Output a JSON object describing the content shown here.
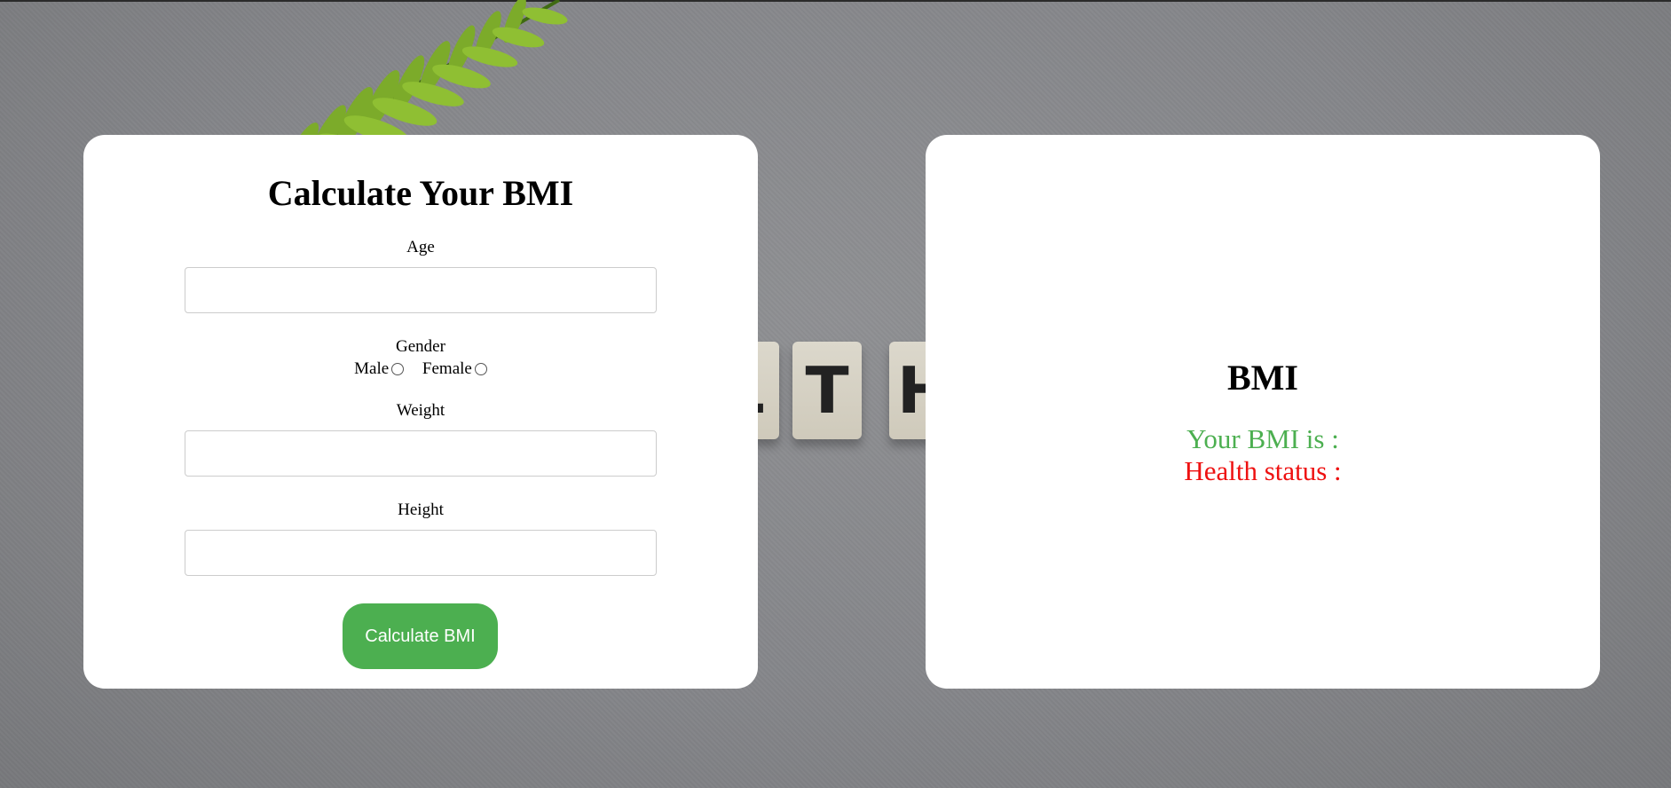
{
  "form": {
    "title": "Calculate Your BMI",
    "age": {
      "label": "Age",
      "value": "",
      "placeholder": ""
    },
    "gender": {
      "label": "Gender",
      "options": [
        {
          "label": "Male",
          "checked": false
        },
        {
          "label": "Female",
          "checked": false
        }
      ]
    },
    "weight": {
      "label": "Weight",
      "value": "",
      "placeholder": ""
    },
    "height": {
      "label": "Height",
      "value": "",
      "placeholder": ""
    },
    "button_label": "Calculate BMI"
  },
  "result": {
    "title": "BMI",
    "bmi_text": "Your BMI is :",
    "status_text": "Health status :"
  },
  "background": {
    "tiles": [
      "L",
      "T",
      "H"
    ]
  },
  "colors": {
    "accent": "#4caf50",
    "status": "#ee1111",
    "card": "#ffffff"
  }
}
